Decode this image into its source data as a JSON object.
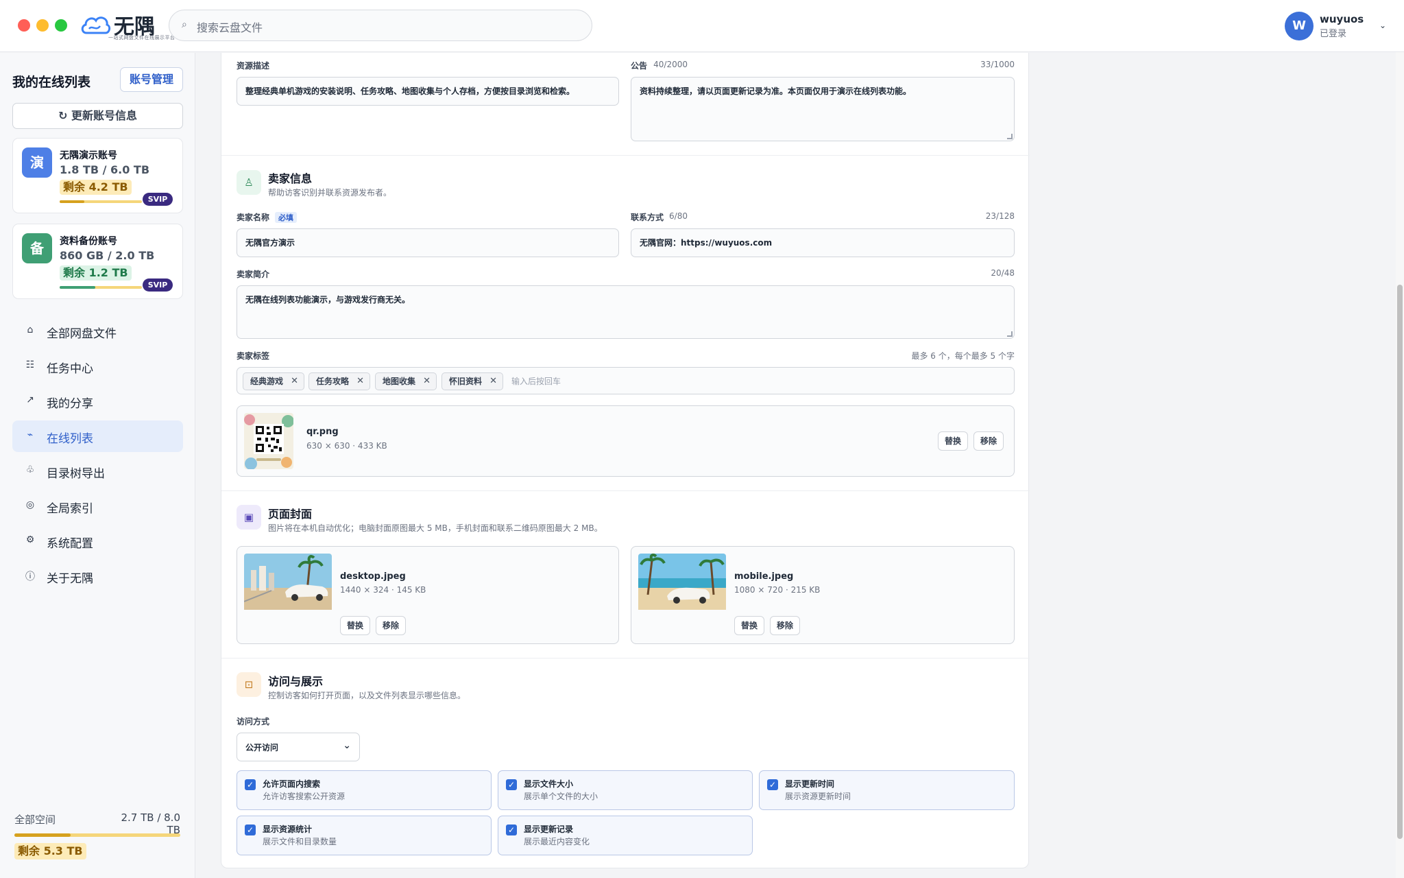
{
  "app": {
    "name": "无隅",
    "tagline": "一站式网盘文件在线展示平台"
  },
  "search": {
    "placeholder": "搜索云盘文件"
  },
  "user": {
    "initial": "W",
    "name": "wuyuos",
    "status": "已登录"
  },
  "sidebar": {
    "title": "我的在线列表",
    "manage_label": "账号管理",
    "refresh_label": "更新账号信息",
    "accounts": [
      {
        "icon": "演",
        "name": "无隅演示账号",
        "capacity": "1.8 TB / 6.0 TB",
        "remaining": "剩余 4.2 TB",
        "badge": "SVIP",
        "used_fraction": 0.3,
        "color": "#4e7fe6"
      },
      {
        "icon": "备",
        "name": "资料备份账号",
        "capacity": "860 GB / 2.0 TB",
        "remaining": "剩余 1.2 TB",
        "badge": "SVIP",
        "used_fraction": 0.43,
        "color": "#3f9f74"
      }
    ],
    "nav": [
      {
        "icon": "⌂",
        "label": "全部网盘文件",
        "active": false
      },
      {
        "icon": "☷",
        "label": "任务中心",
        "active": false
      },
      {
        "icon": "↗",
        "label": "我的分享",
        "active": false
      },
      {
        "icon": "⌁",
        "label": "在线列表",
        "active": true
      },
      {
        "icon": "♧",
        "label": "目录树导出",
        "active": false
      },
      {
        "icon": "◎",
        "label": "全局索引",
        "active": false
      },
      {
        "icon": "⚙",
        "label": "系统配置",
        "active": false
      },
      {
        "icon": "ⓘ",
        "label": "关于无隅",
        "active": false
      }
    ],
    "storage": {
      "label": "全部空间",
      "value": "2.7 TB / 8.0 TB",
      "remaining": "剩余 5.3 TB",
      "used_fraction": 0.34
    }
  },
  "form": {
    "resource": {
      "desc_label": "资源描述",
      "desc_count": "40/2000",
      "desc_value": "整理经典单机游戏的安装说明、任务攻略、地图收集与个人存档，方便按目录浏览和检索。",
      "notice_label": "公告",
      "notice_count": "33/1000",
      "notice_value": "资料持续整理，请以页面更新记录为准。本页面仅用于演示在线列表功能。"
    },
    "seller": {
      "title": "卖家信息",
      "subtitle": "帮助访客识别并联系资源发布者。",
      "name_label": "卖家名称",
      "name_required": "必填",
      "name_count": "6/80",
      "name_value": "无隅官方演示",
      "contact_label": "联系方式",
      "contact_count": "23/128",
      "contact_value": "无隅官网：https://wuyuos.com",
      "intro_label": "卖家简介",
      "intro_count": "20/48",
      "intro_value": "无隅在线列表功能演示，与游戏发行商无关。",
      "tags_label": "卖家标签",
      "tags_hint": "最多 6 个，每个最多 5 个字",
      "tags": [
        "经典游戏",
        "任务攻略",
        "地图收集",
        "怀旧资料"
      ],
      "tags_placeholder": "输入后按回车",
      "qr": {
        "name": "qr.png",
        "meta": "630 × 630 · 433 KB",
        "replace": "替换",
        "remove": "移除"
      }
    },
    "cover": {
      "title": "页面封面",
      "subtitle": "图片将在本机自动优化；电脑封面原图最大 5 MB，手机封面和联系二维码原图最大 2 MB。",
      "desktop": {
        "name": "desktop.jpeg",
        "meta": "1440 × 324 · 145 KB",
        "replace": "替换",
        "remove": "移除"
      },
      "mobile": {
        "name": "mobile.jpeg",
        "meta": "1080 × 720 · 215 KB",
        "replace": "替换",
        "remove": "移除"
      }
    },
    "access": {
      "title": "访问与展示",
      "subtitle": "控制访客如何打开页面，以及文件列表显示哪些信息。",
      "mode_label": "访问方式",
      "mode_value": "公开访问",
      "options": [
        {
          "title": "允许页面内搜索",
          "sub": "允许访客搜索公开资源",
          "checked": true
        },
        {
          "title": "显示文件大小",
          "sub": "展示单个文件的大小",
          "checked": true
        },
        {
          "title": "显示更新时间",
          "sub": "展示资源更新时间",
          "checked": true
        },
        {
          "title": "显示资源统计",
          "sub": "展示文件和目录数量",
          "checked": true
        },
        {
          "title": "显示更新记录",
          "sub": "展示最近内容变化",
          "checked": true
        }
      ]
    }
  }
}
